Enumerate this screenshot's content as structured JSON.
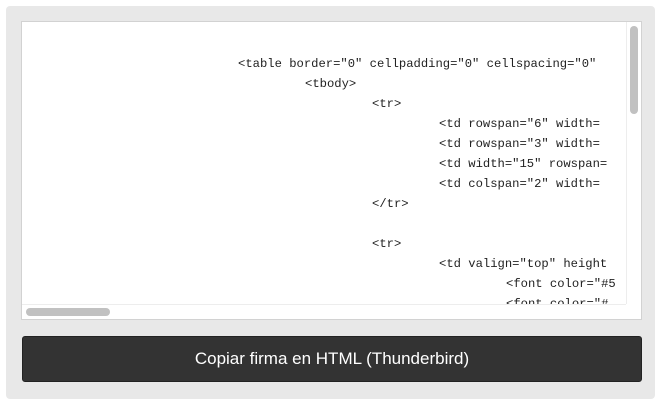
{
  "code": {
    "lines": [
      "<table border=\"0\" cellpadding=\"0\" cellspacing=\"0\"",
      "<tbody>",
      "<tr>",
      "<td rowspan=\"6\" width=",
      "<td rowspan=\"3\" width=",
      "<td width=\"15\" rowspan=",
      "<td colspan=\"2\" width=",
      "</tr>",
      "",
      "<tr>",
      "<td valign=\"top\" height",
      "<font color=\"#5",
      "<font color=\"#"
    ]
  },
  "button": {
    "label": "Copiar firma en HTML (Thunderbird)"
  },
  "colors": {
    "panel_bg": "#e8e8e8",
    "button_bg": "#333333",
    "button_text": "#ffffff",
    "code_text": "#222222"
  }
}
